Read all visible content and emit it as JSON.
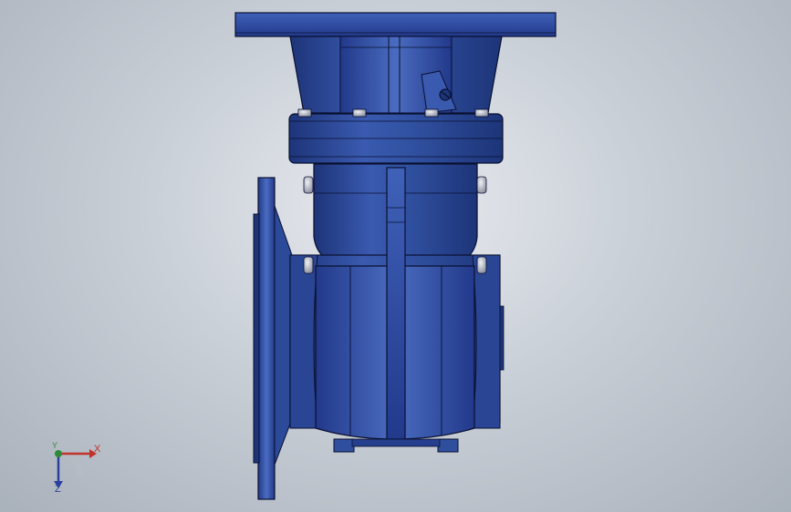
{
  "viewport": {
    "background_top": "#e8ebef",
    "background_bottom": "#a9b1bb"
  },
  "model": {
    "body_color": "#2f4f9e",
    "body_dark": "#1d3478",
    "body_light": "#4a6cc0",
    "edge_color": "#0a1030",
    "bolt_color": "#c9ccd6"
  },
  "triad": {
    "x_label": "X",
    "y_label": "Y",
    "z_label": "Z",
    "x_color": "#c0322b",
    "y_color": "#2e8b3a",
    "z_color": "#2a3f9e"
  }
}
